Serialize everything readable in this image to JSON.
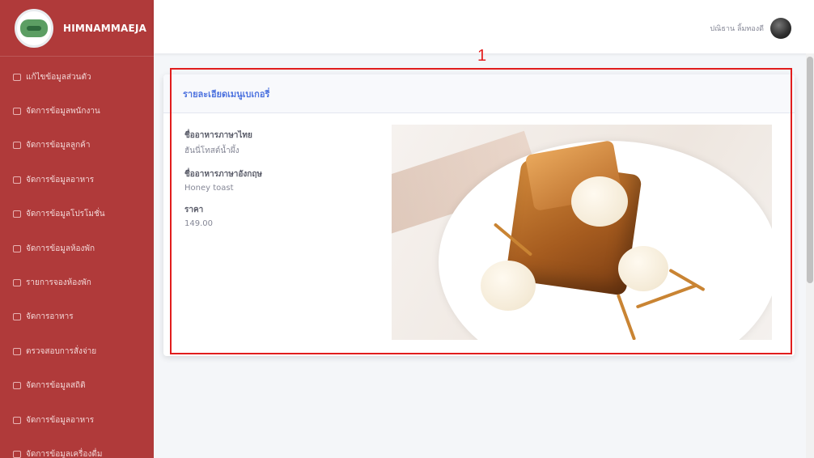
{
  "sidebar": {
    "brand": "HIMNAMMAEJA",
    "items": [
      {
        "label": "แก้ไขข้อมูลส่วนตัว"
      },
      {
        "label": "จัดการข้อมูลพนักงาน"
      },
      {
        "label": "จัดการข้อมูลลูกค้า"
      },
      {
        "label": "จัดการข้อมูลอาหาร"
      },
      {
        "label": "จัดการข้อมูลโปรโมชั่น"
      },
      {
        "label": "จัดการข้อมูลห้องพัก"
      },
      {
        "label": "รายการจองห้องพัก"
      },
      {
        "label": "จัดการอาหาร"
      },
      {
        "label": "ตรวจสอบการสั่งจ่าย"
      },
      {
        "label": "จัดการข้อมูลสถิติ"
      },
      {
        "label": "จัดการข้อมูลอาหาร"
      },
      {
        "label": "จัดการข้อมูลเครื่องดื่ม"
      }
    ]
  },
  "topbar": {
    "user_name": "ปณิธาน ลิ้มทองดี"
  },
  "annotation": {
    "marker": "1"
  },
  "card": {
    "title": "รายละเอียดเมนูเบเกอรี่",
    "fields": [
      {
        "label": "ชื่ออาหารภาษาไทย",
        "value": "ฮันนี่โทสต์น้ำผึ้ง"
      },
      {
        "label": "ชื่ออาหารภาษาอังกฤษ",
        "value": "Honey toast"
      },
      {
        "label": "ราคา",
        "value": "149.00"
      }
    ]
  },
  "colors": {
    "sidebar_bg": "#b03a3a",
    "title_blue": "#4e73df",
    "highlight_red": "#e11d1d"
  }
}
